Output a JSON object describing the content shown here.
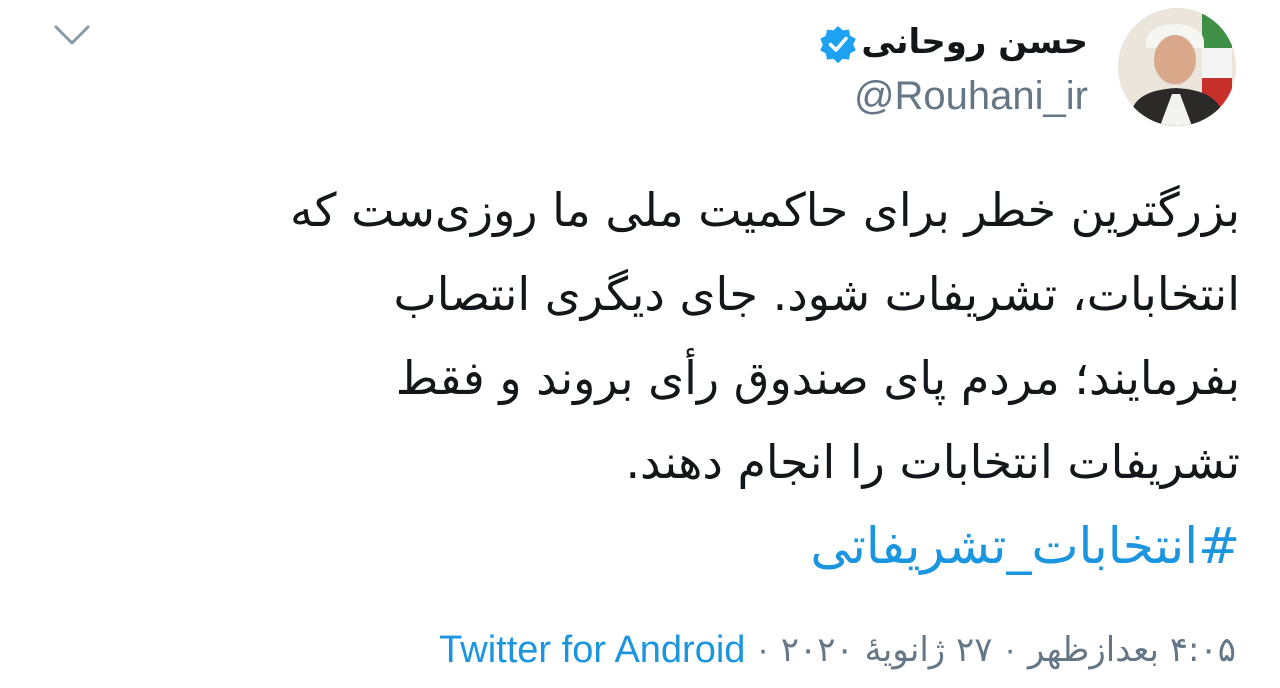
{
  "author": {
    "name": "حسن روحانی",
    "handle": "@Rouhani_ir",
    "verified": true,
    "avatar_icon": "profile-photo"
  },
  "tweet": {
    "lines": [
      "بزرگترین خطر برای حاکمیت ملی ما روزی‌ست که",
      "انتخابات، تشریفات شود. جای دیگری انتصاب",
      "بفرمایند؛ مردم پای صندوق رأی بروند و فقط",
      "تشریفات انتخابات را انجام دهند."
    ],
    "hashtag": "#انتخابات_تشریفاتی"
  },
  "meta": {
    "time": "۴:۰۵ بعدازظهر",
    "date": "۲۷ ژانویهٔ ۲۰۲۰",
    "source": "Twitter for Android",
    "separator": "·"
  },
  "colors": {
    "text": "#14171a",
    "secondary": "#657786",
    "link": "#1b95e0",
    "verified_badge": "#1da1f2"
  },
  "icons": {
    "menu": "chevron-down-icon",
    "verified": "verified-badge-icon"
  }
}
